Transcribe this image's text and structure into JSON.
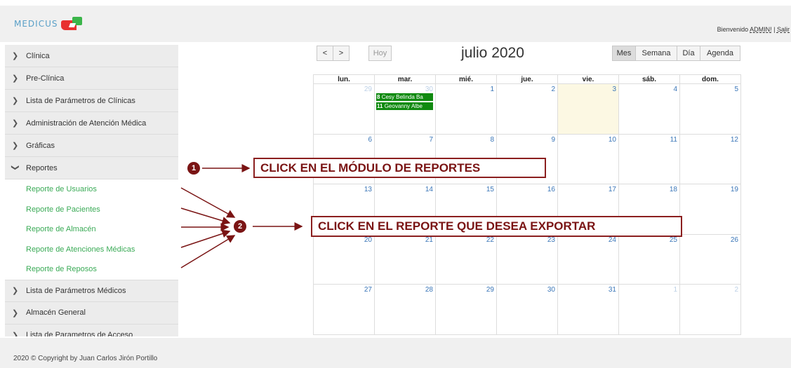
{
  "header": {
    "logo_text": "MEDICUS",
    "welcome_prefix": "Bienvenido",
    "user": "ADMIN!",
    "separator": " | ",
    "logout": "Salir"
  },
  "sidebar": {
    "items_top": [
      {
        "label": "Clínica"
      },
      {
        "label": "Pre-Clínica"
      },
      {
        "label": "Lista de Parámetros de Clínicas"
      },
      {
        "label": "Administración de Atención Médica"
      },
      {
        "label": "Gráficas"
      },
      {
        "label": "Reportes"
      }
    ],
    "reportes_sub": [
      {
        "label": "Reporte de Usuarios"
      },
      {
        "label": "Reporte de Pacientes"
      },
      {
        "label": "Reporte de Almacén"
      },
      {
        "label": "Reporte de Atenciones Médicas"
      },
      {
        "label": "Reporte de Reposos"
      }
    ],
    "items_bottom": [
      {
        "label": "Lista de Parámetros Médicos"
      },
      {
        "label": "Almacén General"
      },
      {
        "label": "Lista de Parametros de Acceso"
      }
    ]
  },
  "calendar": {
    "prev": "<",
    "next": ">",
    "today": "Hoy",
    "title": "julio 2020",
    "views": [
      "Mes",
      "Semana",
      "Día",
      "Agenda"
    ],
    "weekdays": [
      "lun.",
      "mar.",
      "mié.",
      "jue.",
      "vie.",
      "sáb.",
      "dom."
    ],
    "weeks": [
      [
        "29",
        "30",
        "1",
        "2",
        "3",
        "4",
        "5"
      ],
      [
        "6",
        "7",
        "8",
        "9",
        "10",
        "11",
        "12"
      ],
      [
        "13",
        "14",
        "15",
        "16",
        "17",
        "18",
        "19"
      ],
      [
        "20",
        "21",
        "22",
        "23",
        "24",
        "25",
        "26"
      ],
      [
        "27",
        "28",
        "29",
        "30",
        "31",
        "1",
        "2"
      ]
    ],
    "events": [
      {
        "time": "8",
        "text": "Cesy Belinda Ba"
      },
      {
        "time": "11",
        "text": "Geovanny Albe"
      }
    ]
  },
  "annotations": {
    "step1_num": "1",
    "step1_text": "CLICK EN EL MÓDULO DE REPORTES",
    "step2_num": "2",
    "step2_text": "CLICK EN EL  REPORTE QUE DESEA EXPORTAR"
  },
  "footer": {
    "copyright": "2020 © Copyright by Juan Carlos Jirón Portillo"
  },
  "colors": {
    "accent_green": "#3bab57",
    "event_green": "#108a10",
    "annotation_red": "#7a1414",
    "day_number_blue": "#3a76b8",
    "today_bg": "#fcf8e3"
  }
}
